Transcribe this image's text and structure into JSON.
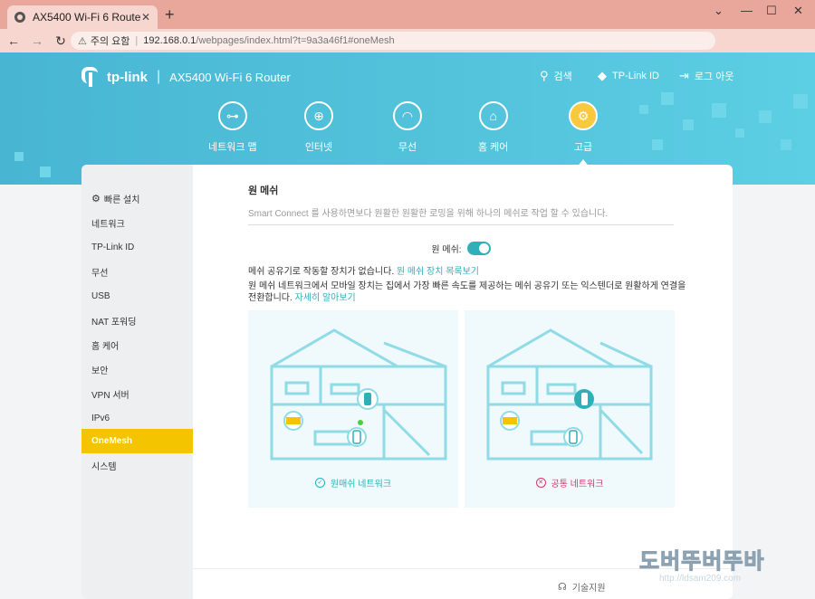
{
  "browser": {
    "tab_title": "AX5400 Wi-Fi 6 Router",
    "tab_close": "✕",
    "new_tab": "+",
    "window_controls": [
      "⌄",
      "—",
      "☐",
      "✕"
    ],
    "security_label": "주의 요함",
    "url_host": "192.168.0.1",
    "url_path": "/webpages/index.html?t=9a3a46f1#oneMesh"
  },
  "header": {
    "brand": "tp-link",
    "separator": "|",
    "model": "AX5400 Wi-Fi 6 Router",
    "links": [
      {
        "icon": "search-icon",
        "label": "검색"
      },
      {
        "icon": "tplink-id-icon",
        "label": "TP-Link ID"
      },
      {
        "icon": "logout-icon",
        "label": "로그 아웃"
      }
    ]
  },
  "main_nav": [
    {
      "icon": "network-map-icon",
      "label": "네트워크 맵",
      "active": false
    },
    {
      "icon": "globe-icon",
      "label": "인터넷",
      "active": false
    },
    {
      "icon": "wifi-icon",
      "label": "무선",
      "active": false
    },
    {
      "icon": "home-care-icon",
      "label": "홈 케어",
      "active": false
    },
    {
      "icon": "gear-icon",
      "label": "고급",
      "active": true
    }
  ],
  "sidebar": {
    "items": [
      {
        "label": "빠른 설치",
        "active": false
      },
      {
        "label": "네트워크",
        "active": false
      },
      {
        "label": "TP-Link ID",
        "active": false
      },
      {
        "label": "무선",
        "active": false
      },
      {
        "label": "USB",
        "active": false
      },
      {
        "label": "NAT 포워딩",
        "active": false
      },
      {
        "label": "홈 케어",
        "active": false
      },
      {
        "label": "보안",
        "active": false
      },
      {
        "label": "VPN 서버",
        "active": false
      },
      {
        "label": "IPv6",
        "active": false
      },
      {
        "label": "OneMesh",
        "active": true
      },
      {
        "label": "시스템",
        "active": false
      }
    ]
  },
  "onemesh": {
    "title": "원 메쉬",
    "description": "Smart Connect 를 사용하면보다 원활한 원활한 로밍을 위해 하나의 메쉬로 작업 할 수 있습니다.",
    "toggle_label": "원 메쉬:",
    "toggle_on": true,
    "no_devices_text": "메쉬 공유기로 작동할 장치가 없습니다.",
    "device_list_link": "원 메쉬 장치 목록보기",
    "explain_text": "원 메쉬 네트워크에서 모바일 장치는 집에서 가장 빠른 속도를 제공하는 메쉬 공유기 또는 익스텐더로 원활하게 연결을 전환합니다.",
    "learn_more_link": "자세히 알아보기",
    "panels": [
      {
        "caption": "원매쉬 네트워크",
        "caption_icon": "check-circle-icon",
        "color": "#2fb0b9"
      },
      {
        "caption": "공통 네트워크",
        "caption_icon": "x-circle-icon",
        "color": "#d23a6a"
      }
    ]
  },
  "footer": {
    "support_label": "기술지원"
  },
  "watermark": {
    "big": "도버뚜버뚜바",
    "small": "http://ldsam209.com"
  },
  "colors": {
    "accent_teal": "#2fb0b9",
    "header_blue": "#4fbfd9",
    "active_yellow": "#f5c400"
  }
}
